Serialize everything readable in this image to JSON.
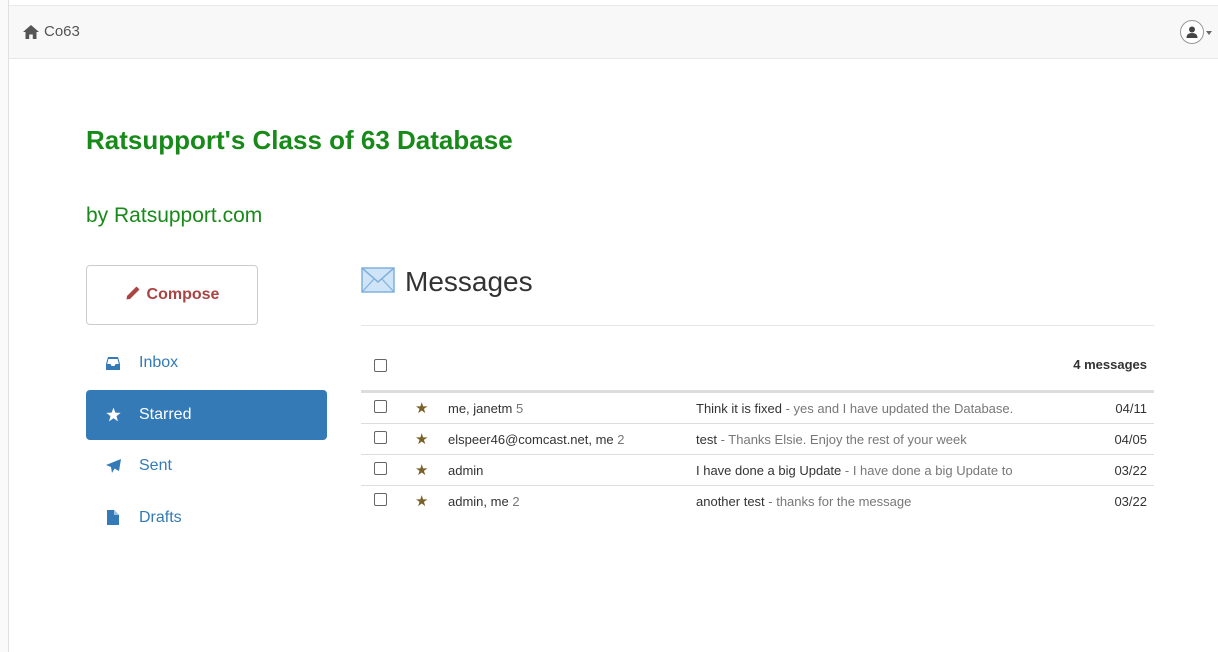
{
  "navbar": {
    "brand_label": "Co63",
    "brand_icon": "home-icon",
    "user_icon": "user-icon"
  },
  "header": {
    "title": "Ratsupport's Class of 63 Database",
    "subtitle": "by Ratsupport.com"
  },
  "sidebar": {
    "compose_label": "Compose",
    "items": [
      {
        "label": "Inbox",
        "icon": "inbox-icon",
        "active": false
      },
      {
        "label": "Starred",
        "icon": "star-icon",
        "active": true
      },
      {
        "label": "Sent",
        "icon": "send-icon",
        "active": false
      },
      {
        "label": "Drafts",
        "icon": "file-icon",
        "active": false
      }
    ]
  },
  "main": {
    "title": "Messages",
    "count_label": "4 messages",
    "messages": [
      {
        "from": "me, janetm",
        "count": "5",
        "subject": "Think it is fixed",
        "snippet": " - yes and I have updated the Database.",
        "date": "04/11"
      },
      {
        "from": "elspeer46@comcast.net, me",
        "count": "2",
        "subject": "test",
        "snippet": " - Thanks Elsie. Enjoy the rest of your week",
        "date": "04/05"
      },
      {
        "from": "admin",
        "count": "",
        "subject": "I have done a big Update",
        "snippet": " - I have done a big Update to",
        "date": "03/22"
      },
      {
        "from": "admin, me",
        "count": "2",
        "subject": "another test",
        "snippet": " - thanks for the message",
        "date": "03/22"
      }
    ]
  },
  "colors": {
    "title_green": "#188a1a",
    "accent_blue": "#337ab7",
    "compose_red": "#a94442",
    "star_brown": "#7a6129"
  }
}
